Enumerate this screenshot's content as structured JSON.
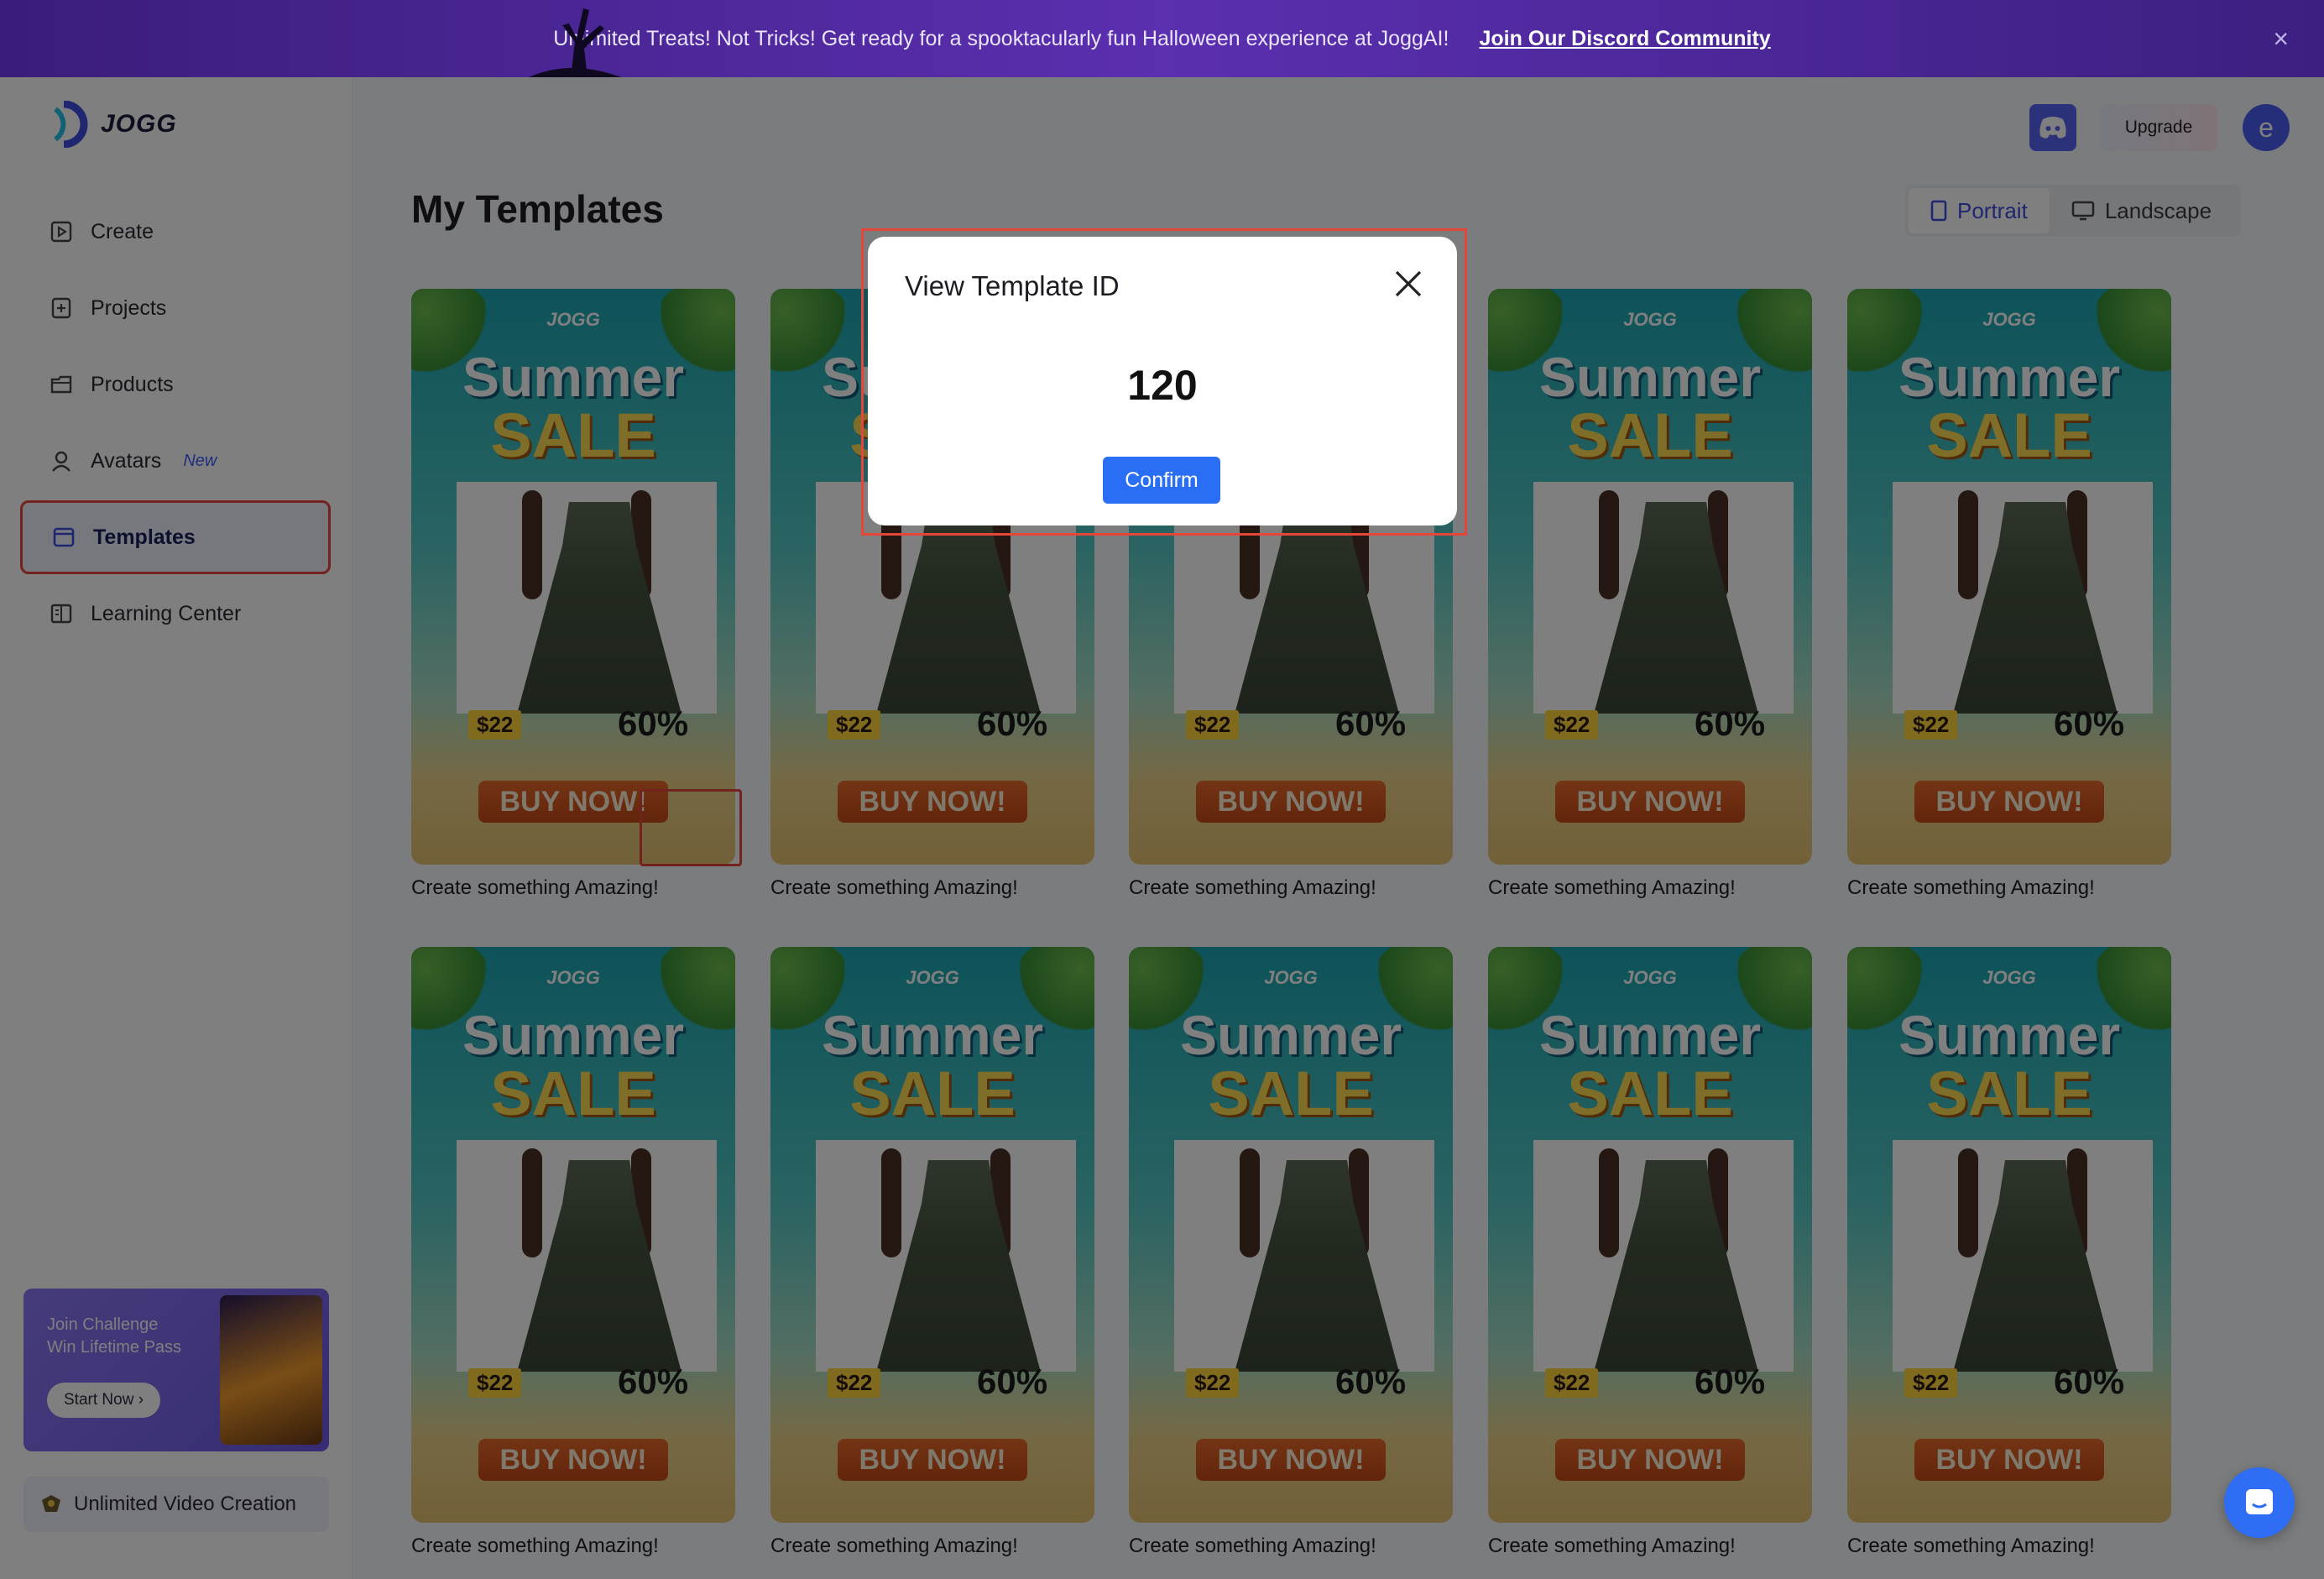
{
  "banner": {
    "message": "Unlimited Treats! Not Tricks! Get ready for a spooktacularly fun Halloween experience at JoggAI!",
    "link": "Join Our Discord Community",
    "close": "×"
  },
  "brand": {
    "name": "JOGG"
  },
  "sidebar": {
    "items": [
      {
        "label": "Create",
        "icon": "create-icon"
      },
      {
        "label": "Projects",
        "icon": "projects-icon"
      },
      {
        "label": "Products",
        "icon": "products-icon"
      },
      {
        "label": "Avatars",
        "icon": "avatar-icon",
        "badge": "New"
      },
      {
        "label": "Templates",
        "icon": "templates-icon",
        "active": true
      },
      {
        "label": "Learning Center",
        "icon": "learning-icon"
      }
    ],
    "challenge": {
      "line1": "Join Challenge",
      "line2": "Win Lifetime Pass",
      "button": "Start Now ›"
    },
    "unlimited": "Unlimited Video Creation"
  },
  "header": {
    "upgrade": "Upgrade",
    "avatar_letter": "e"
  },
  "main": {
    "title": "My Templates",
    "orientation": {
      "portrait": "Portrait",
      "landscape": "Landscape",
      "selected": "Portrait"
    },
    "template_card": {
      "logo": "JOGG",
      "headline1": "Summer",
      "headline2": "SALE",
      "price": "$22",
      "discount": "60%",
      "cta": "BUY NOW!",
      "caption": "Create something Amazing!"
    }
  },
  "modal": {
    "title": "View Template ID",
    "template_id": "120",
    "confirm": "Confirm"
  },
  "colors": {
    "accent": "#2a6ef5",
    "highlight": "#e5463a",
    "banner": "#4a2596"
  }
}
